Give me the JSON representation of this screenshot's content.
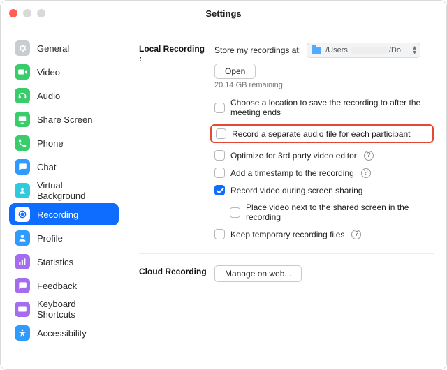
{
  "window": {
    "title": "Settings"
  },
  "sidebar": {
    "items": [
      {
        "label": "General",
        "color": "#c9ccd1"
      },
      {
        "label": "Video",
        "color": "#39cc6a"
      },
      {
        "label": "Audio",
        "color": "#39cc6a"
      },
      {
        "label": "Share Screen",
        "color": "#39cc6a"
      },
      {
        "label": "Phone",
        "color": "#39cc6a"
      },
      {
        "label": "Chat",
        "color": "#2f9bff"
      },
      {
        "label": "Virtual Background",
        "color": "#2fc9e0"
      },
      {
        "label": "Recording",
        "color": "#2f9bff"
      },
      {
        "label": "Profile",
        "color": "#2f9bff"
      },
      {
        "label": "Statistics",
        "color": "#a56cf0"
      },
      {
        "label": "Feedback",
        "color": "#a56cf0"
      },
      {
        "label": "Keyboard Shortcuts",
        "color": "#a56cf0"
      },
      {
        "label": "Accessibility",
        "color": "#2f9bff"
      }
    ],
    "active_index": 7
  },
  "local": {
    "heading": "Local Recording :",
    "store_label": "Store my recordings at:",
    "path_prefix": "/Users,",
    "path_suffix": "/Do...",
    "open_button": "Open",
    "remaining": "20.14 GB remaining",
    "options": [
      {
        "label": "Choose a location to save the recording to after the meeting ends",
        "checked": false,
        "help": false,
        "highlight": false
      },
      {
        "label": "Record a separate audio file for each participant",
        "checked": false,
        "help": false,
        "highlight": true
      },
      {
        "label": "Optimize for 3rd party video editor",
        "checked": false,
        "help": true,
        "highlight": false
      },
      {
        "label": "Add a timestamp to the recording",
        "checked": false,
        "help": true,
        "highlight": false
      },
      {
        "label": "Record video during screen sharing",
        "checked": true,
        "help": false,
        "highlight": false
      },
      {
        "label": "Place video next to the shared screen in the recording",
        "checked": false,
        "help": false,
        "highlight": false,
        "sub": true
      },
      {
        "label": "Keep temporary recording files",
        "checked": false,
        "help": true,
        "highlight": false
      }
    ]
  },
  "cloud": {
    "heading": "Cloud Recording",
    "manage_button": "Manage on web..."
  }
}
